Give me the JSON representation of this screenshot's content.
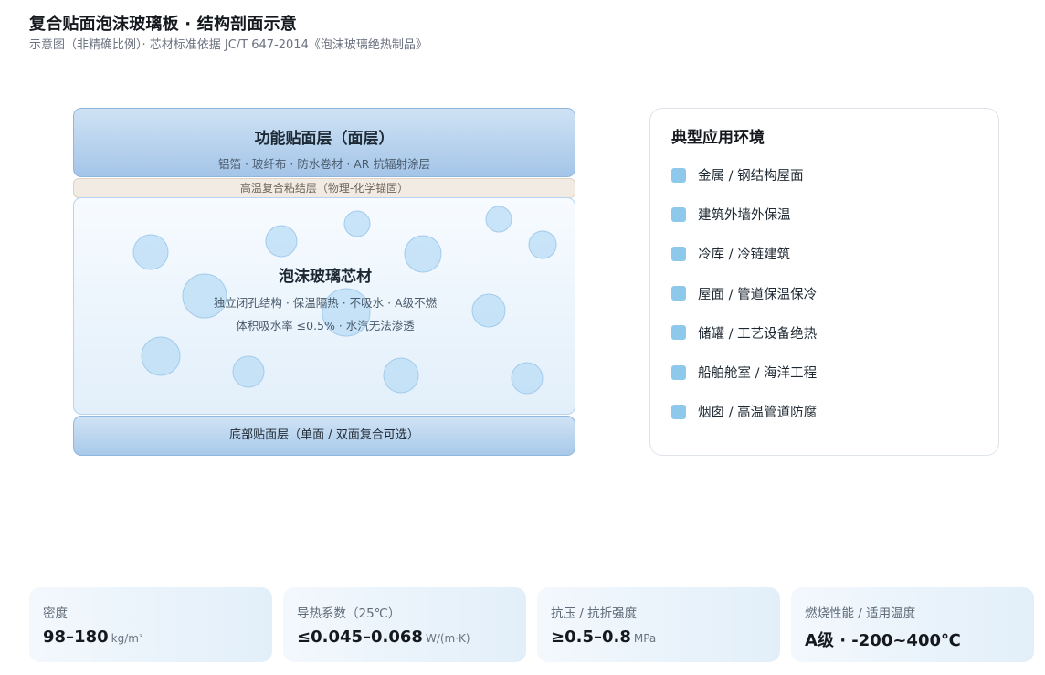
{
  "header": {
    "title": "复合贴面泡沫玻璃板 · 结构剖面示意",
    "subtitle": "示意图（非精确比例）· 芯材标准依据 JC/T 647-2014《泡沫玻璃绝热制品》"
  },
  "layers": {
    "top": {
      "title": "功能贴面层（面层）",
      "desc": "铝箔 · 玻纤布 · 防水卷材 · AR 抗辐射涂层"
    },
    "adhesive": {
      "label": "高温复合粘结层（物理-化学锚固）"
    },
    "core": {
      "title": "泡沫玻璃芯材",
      "desc1": "独立闭孔结构 · 保温隔热 · 不吸水 · A级不燃",
      "desc2": "体积吸水率 ≤0.5% · 水汽无法渗透"
    },
    "bottom": {
      "label": "底部贴面层（单面 / 双面复合可选）"
    }
  },
  "applications": {
    "title": "典型应用环境",
    "items": [
      "金属 / 钢结构屋面",
      "建筑外墙外保温",
      "冷库 / 冷链建筑",
      "屋面 / 管道保温保冷",
      "储罐 / 工艺设备绝热",
      "船舶舱室 / 海洋工程",
      "烟囱 / 高温管道防腐"
    ]
  },
  "specs": [
    {
      "label": "密度",
      "value": "98–180",
      "unit": "kg/m³"
    },
    {
      "label": "导热系数（25℃）",
      "value": "≤0.045–0.068",
      "unit": "W/(m·K)"
    },
    {
      "label": "抗压 / 抗折强度",
      "value": "≥0.5–0.8",
      "unit": "MPa"
    },
    {
      "label": "燃烧性能 / 适用温度",
      "value": "A级 · -200~400℃",
      "unit": ""
    }
  ],
  "colors": {
    "face_layer": "#a4c5e8",
    "adhesive_layer": "#f1ebe4",
    "core_layer": "#e2effa",
    "bubble": "#b9dcf5",
    "marker": "#8ec8eb"
  }
}
